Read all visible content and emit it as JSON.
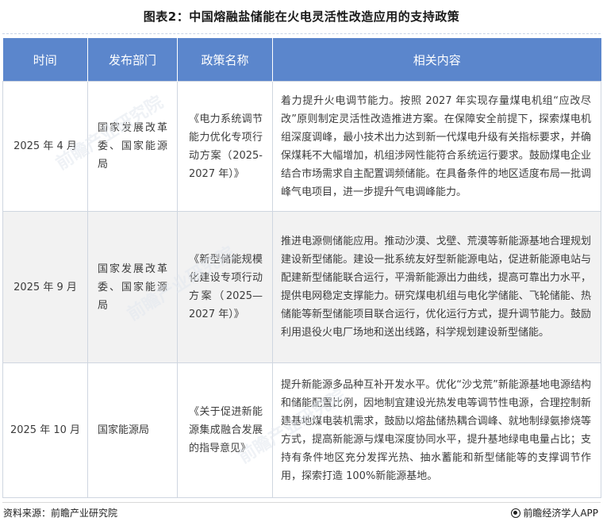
{
  "title": "图表2：中国熔融盐储能在火电灵活性改造应用的支持政策",
  "table": {
    "headers": [
      "时间",
      "发布部门",
      "政策名称",
      "相关内容"
    ],
    "rows": [
      {
        "time": "2025 年 4 月",
        "dept": "国家发展改革委、国家能源局",
        "name": "《电力系统调节能力优化专项行动方案（2025-2027 年）》",
        "content": "着力提升火电调节能力。按照 2027 年实现存量煤电机组“应改尽改”原则制定灵活性改造推进方案。在保障安全前提下，探索煤电机组深度调峰，最小技术出力达到新一代煤电升级有关指标要求，并确保煤耗不大幅增加，机组涉网性能符合系统运行要求。鼓励煤电企业结合市场需求自主配置调频储能。在具备条件的地区适度布局一批调峰气电项目，进一步提升气电调峰能力。"
      },
      {
        "time": "2025 年 9 月",
        "dept": "国家发展改革委、国家能源局",
        "name": "《新型储能规模化建设专项行动方案（2025—2027 年）》",
        "content": "推进电源侧储能应用。推动沙漠、戈壁、荒漠等新能源基地合理规划建设新型储能。建设一批系统友好型新能源电站，促进新能源电站与配建新型储能联合运行，平滑新能源出力曲线，提高可靠出力水平，提供电网稳定支撑能力。研究煤电机组与电化学储能、飞轮储能、热储能等新型储能项目联合运行，优化运行方式，提升调节能力。鼓励利用退役火电厂场地和送出线路，科学规划建设新型储能。"
      },
      {
        "time": "2025 年 10 月",
        "dept": "国家能源局",
        "name": "《关于促进新能源集成融合发展的指导意见》",
        "content": "提升新能源多品种互补开发水平。优化“沙戈荒”新能源基地电源结构和储能配置比例，因地制宜建设光热发电等调节性电源，合理控制新建基地煤电装机需求，鼓励以熔盐储热耦合调峰、就地制绿氨掺烧等方式，提高新能源与煤电深度协同水平，提升基地绿电电量占比；支持有条件地区充分发挥光热、抽水蓄能和新型储能等的支撑调节作用，探索打造 100%新能源基地。"
      }
    ]
  },
  "watermark": "前瞻产业研究院",
  "footer": {
    "source": "资料来源：前瞻产业研究院",
    "brand": "前瞻经济学人APP"
  }
}
